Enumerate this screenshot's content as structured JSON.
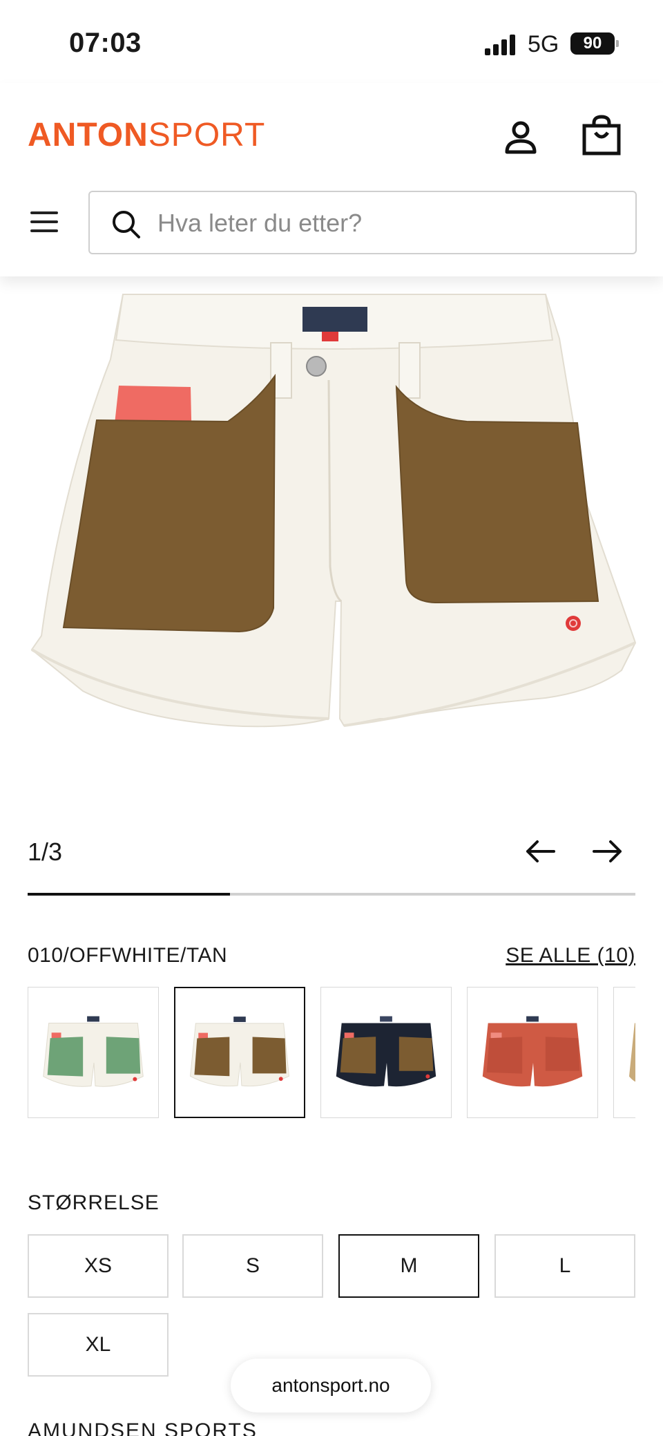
{
  "status_bar": {
    "time": "07:03",
    "network": "5G",
    "battery": "90"
  },
  "header": {
    "logo_bold": "ANTON",
    "logo_light": "SPORT",
    "search_placeholder": "Hva leter du etter?",
    "colors": {
      "brand": "#ef5a24"
    }
  },
  "gallery": {
    "counter": "1/3",
    "progress_fraction": 0.333
  },
  "variants": {
    "selected_label": "010/OFFWHITE/TAN",
    "see_all": "SE ALLE (10)",
    "thumbnails": [
      {
        "name": "offwhite-green"
      },
      {
        "name": "offwhite-tan",
        "selected": true
      },
      {
        "name": "navy-tan"
      },
      {
        "name": "rust"
      },
      {
        "name": "tan-partial"
      }
    ]
  },
  "sizes": {
    "label": "STØRRELSE",
    "options": [
      "XS",
      "S",
      "M",
      "L",
      "XL"
    ],
    "selected": "M"
  },
  "brand_heading": "AMUNDSEN SPORTS",
  "browser": {
    "url": "antonsport.no"
  }
}
